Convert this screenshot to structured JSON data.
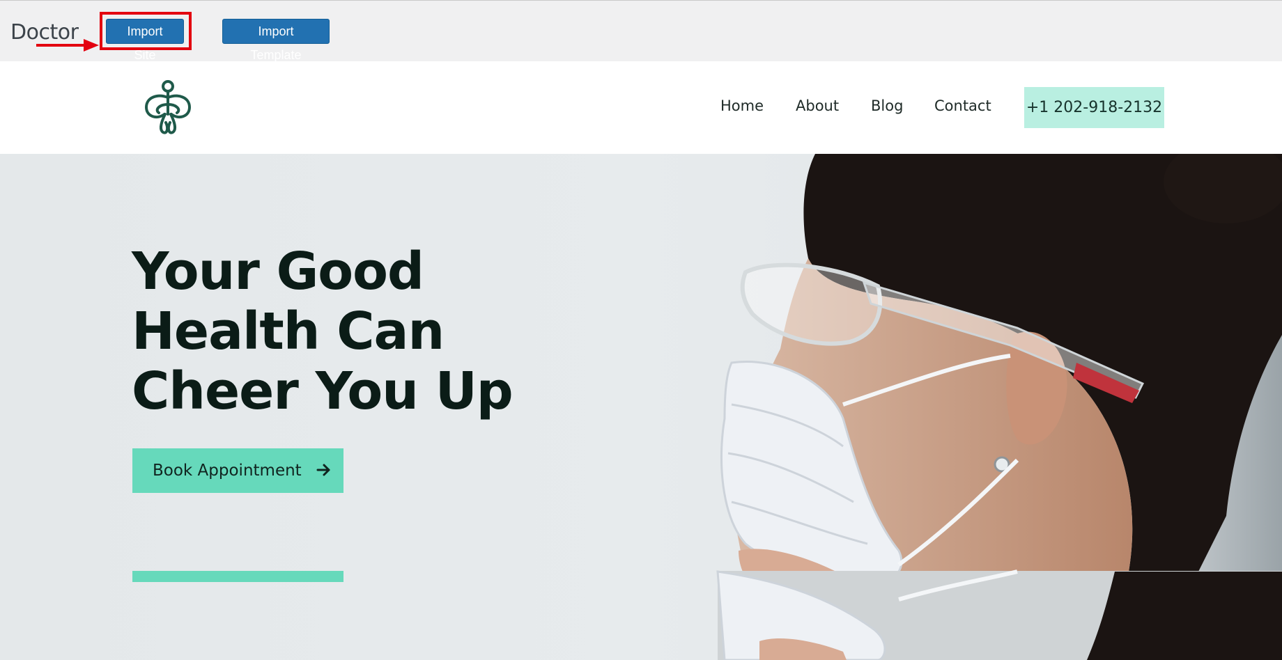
{
  "toolbar": {
    "site_name": "Doctor",
    "import_site_label": "Import Site",
    "import_template_label": "Import Template",
    "highlight_color": "#e3000f",
    "button_color": "#2271b1"
  },
  "header": {
    "logo_icon": "wellness-figure-logo-icon",
    "nav": [
      "Home",
      "About",
      "Blog",
      "Contact"
    ],
    "phone": "+1 202-918-2132"
  },
  "hero": {
    "title_lines": [
      "Your Good",
      "Health Can",
      "Cheer You Up"
    ],
    "cta_label": "Book Appointment",
    "cta_icon": "arrow-right-icon",
    "image": "woman-wearing-face-mask-and-safety-glasses",
    "accent_color": "#66d9bb"
  }
}
